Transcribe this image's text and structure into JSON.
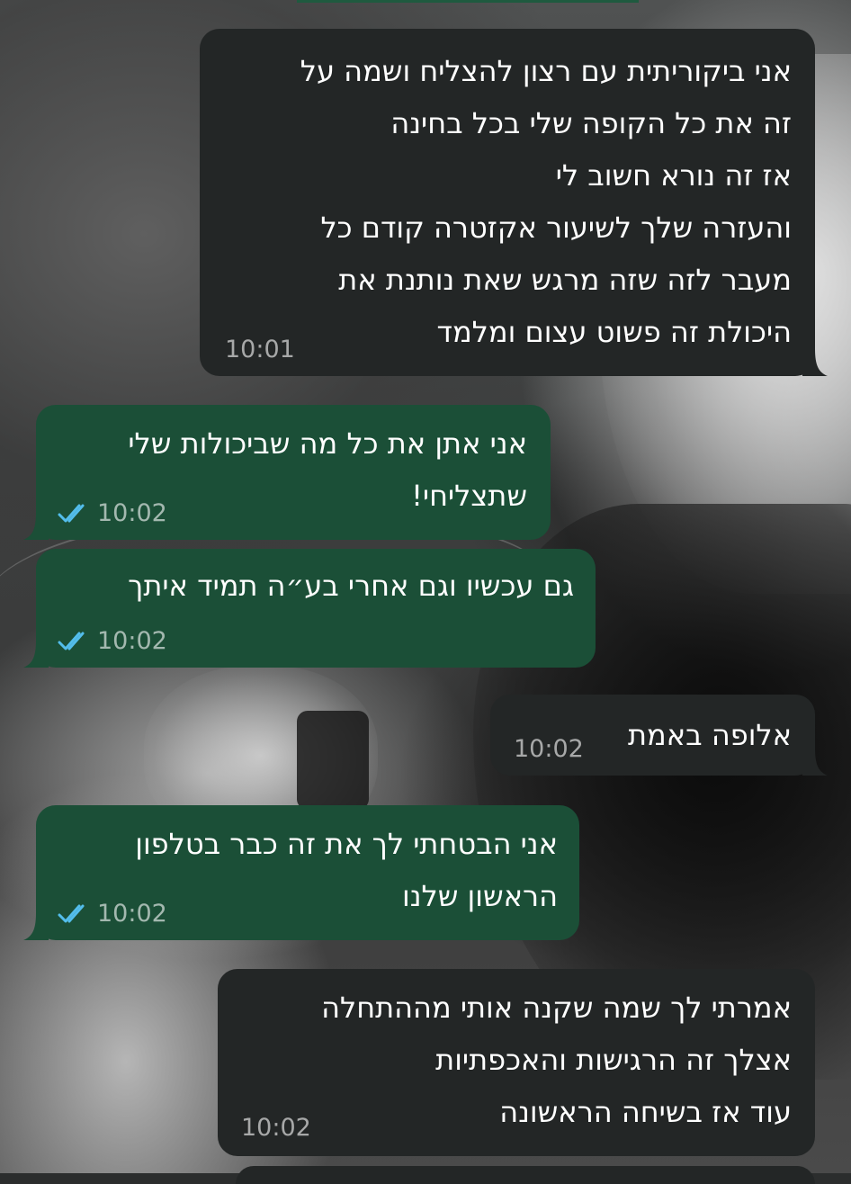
{
  "chat": {
    "messages": [
      {
        "direction": "incoming",
        "lines": [
          "אני ביקוריתית עם רצון להצליח ושמה על",
          "זה את כל הקופה שלי בכל בחינה",
          "אז זה נורא חשוב לי",
          "והעזרה שלך לשיעור אקזטרה קודם כל",
          "מעבר לזה שזה מרגש שאת נותנת את",
          "היכולת זה פשוט עצום ומלמד"
        ],
        "time": "10:01"
      },
      {
        "direction": "outgoing",
        "lines": [
          "אני אתן את כל מה שביכולות שלי",
          "שתצליחי!"
        ],
        "time": "10:02",
        "status_icon": "double-check-read-icon"
      },
      {
        "direction": "outgoing",
        "lines": [
          "גם עכשיו וגם אחרי בע״ה תמיד איתך"
        ],
        "time": "10:02",
        "status_icon": "double-check-read-icon"
      },
      {
        "direction": "incoming",
        "lines": [
          "אלופה באמת"
        ],
        "time": "10:02"
      },
      {
        "direction": "outgoing",
        "lines": [
          "אני הבטחתי לך את זה כבר בטלפון",
          "הראשון שלנו"
        ],
        "time": "10:02",
        "status_icon": "double-check-read-icon"
      },
      {
        "direction": "incoming",
        "lines": [
          "אמרתי לך שמה שקנה אותי מההתחלה",
          "אצלך זה הרגישות והאכפתיות",
          "עוד אז בשיחה הראשונה"
        ],
        "time": "10:02"
      }
    ]
  },
  "colors": {
    "incoming_bubble": "#232626",
    "outgoing_bubble": "#1b4f37",
    "read_ticks": "#53bdeb",
    "text": "#ffffff"
  }
}
